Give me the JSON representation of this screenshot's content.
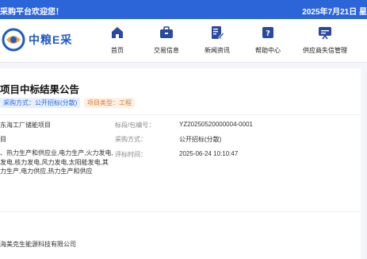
{
  "topbar": {
    "welcome": "采购平台欢迎您！",
    "date": "2025年7月21日 星"
  },
  "brand": {
    "logo_text": "中粮E采",
    "color": "#1d5bc8"
  },
  "nav": {
    "items": [
      {
        "label": "首页",
        "icon": "home-icon"
      },
      {
        "label": "交易信息",
        "icon": "briefcase-icon"
      },
      {
        "label": "新闻资讯",
        "icon": "document-edit-icon"
      },
      {
        "label": "帮助中心",
        "icon": "help-book-icon"
      },
      {
        "label": "供应商失信管理",
        "icon": "presentation-icon"
      }
    ]
  },
  "notice": {
    "title": "项目中标结果公告",
    "tag_method": "采购方式：公开招标(分散)",
    "tag_type": "项目类型：工程",
    "project_name": "东海工厂储能项目",
    "section_label": "标段/包编号：",
    "section_value": "YZ20250520000004-0001",
    "left_short": "目",
    "method_label": "采购方式：",
    "method_value": "公开招标(分散)",
    "industry_lines": [
      "、热力生产和供应业,电力生产,火力发电,",
      "发电,核力发电,风力发电,太阳能发电,其",
      "力生产,电力供应,热力生产和供应"
    ],
    "review_label": "评标时间：",
    "review_value": "2025-06-24 10:10:47",
    "winner": "海美克生能源科技有限公司"
  },
  "colors": {
    "topbar": "#2c65d8",
    "tag_blue": "#2c65d8",
    "tag_orange": "#e0742c"
  }
}
